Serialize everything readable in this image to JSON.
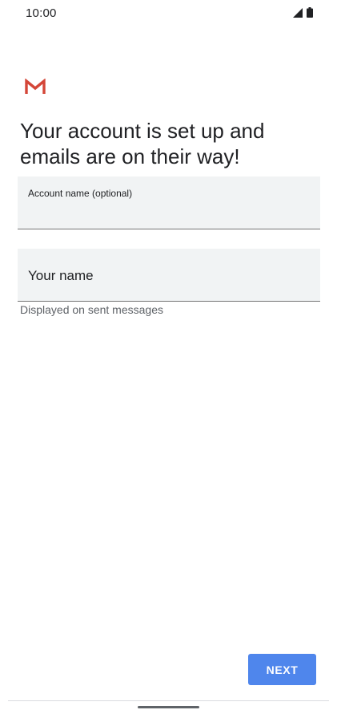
{
  "status_bar": {
    "time": "10:00",
    "icons": [
      "signal-icon",
      "battery-icon"
    ]
  },
  "app": {
    "logo_icon": "gmail-logo-icon",
    "brand_color": "#d44638"
  },
  "main": {
    "headline": "Your account is set up and emails are on their way!",
    "account_field": {
      "label": "Account name (optional)",
      "value": ""
    },
    "name_field": {
      "placeholder": "Your name",
      "value": "",
      "helper": "Displayed on sent messages"
    }
  },
  "footer": {
    "next_label": "NEXT",
    "accent_color": "#4f86ec"
  }
}
